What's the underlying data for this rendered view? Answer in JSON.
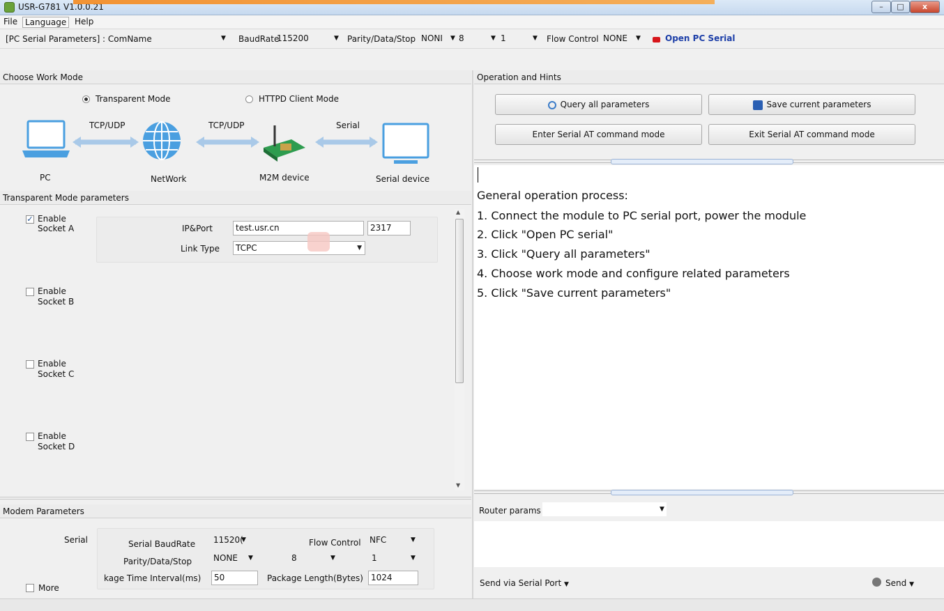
{
  "window": {
    "title": "USR-G781 V1.0.0.21",
    "min": "–",
    "max": "□",
    "close": "x"
  },
  "menu": {
    "file": "File",
    "language": "Language",
    "help": "Help"
  },
  "toolbar": {
    "serial_label": "[PC Serial Parameters] : ComName",
    "comname": "",
    "baud_label": "BaudRate",
    "baud": "115200",
    "parity_label": "Parity/Data/Stop",
    "parity": "NONI",
    "data": "8",
    "stop": "1",
    "flow_label": "Flow Control",
    "flow": "NONE",
    "open_serial": "Open PC Serial"
  },
  "work_mode": {
    "title": "Choose Work Mode",
    "transparent": "Transparent Mode",
    "httpd": "HTTPD Client Mode",
    "diagram": {
      "pc": "PC",
      "network": "NetWork",
      "m2m": "M2M device",
      "serial_device": "Serial device",
      "link1": "TCP/UDP",
      "link2": "TCP/UDP",
      "link3": "Serial"
    }
  },
  "transparent_params": {
    "title": "Transparent Mode parameters",
    "socket_a": {
      "enable": "Enable",
      "name": "Socket A",
      "checked": true
    },
    "socket_b": {
      "enable": "Enable",
      "name": "Socket B",
      "checked": false
    },
    "socket_c": {
      "enable": "Enable",
      "name": "Socket C",
      "checked": false
    },
    "socket_d": {
      "enable": "Enable",
      "name": "Socket D",
      "checked": false
    },
    "ip_label": "IP&Port",
    "ip_value": "test.usr.cn",
    "port_value": "2317",
    "link_label": "Link Type",
    "link_value": "TCPC"
  },
  "modem": {
    "title": "Modem Parameters",
    "serial": "Serial",
    "baud_label": "Serial BaudRate",
    "baud": "11520(",
    "flow_label": "Flow Control",
    "flow": "NFC",
    "parity_label": "Parity/Data/Stop",
    "parity": "NONE",
    "data": "8",
    "stop": "1",
    "interval_label": "kage Time Interval(ms)",
    "interval": "50",
    "pkglen_label": "Package Length(Bytes)",
    "pkglen": "1024",
    "more": "More"
  },
  "operation": {
    "title": "Operation and Hints",
    "query": "Query all parameters",
    "save": "Save current parameters",
    "enter_at": "Enter Serial AT command mode",
    "exit_at": "Exit Serial AT command mode"
  },
  "hints": {
    "heading": "General operation process:",
    "steps": [
      "1. Connect the module to PC serial port, power the module",
      "2. Click \"Open PC serial\"",
      "3. Click \"Query all parameters\"",
      "4. Choose work mode and configure related parameters",
      "5. Click \"Save current parameters\""
    ]
  },
  "router": {
    "label": "Router params",
    "value": ""
  },
  "send": {
    "via": "Send via Serial Port",
    "send": "Send"
  },
  "colors": {
    "accent_blue": "#1d3fa8",
    "led_red": "#d7161b",
    "title_orange": "#f58a1f"
  }
}
